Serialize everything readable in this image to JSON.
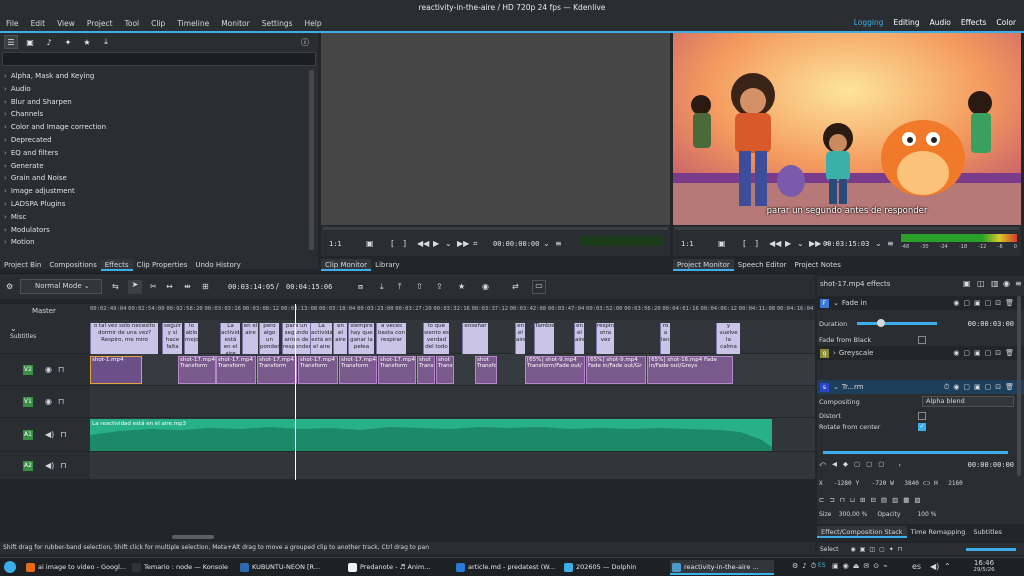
{
  "window": {
    "title": "reactivity-in-the-aire / HD 720p 24 fps — Kdenlive"
  },
  "menu": [
    "File",
    "Edit",
    "View",
    "Project",
    "Tool",
    "Clip",
    "Timeline",
    "Monitor",
    "Settings",
    "Help"
  ],
  "layouts": [
    "Logging",
    "Editing",
    "Audio",
    "Effects",
    "Color"
  ],
  "effects_list": [
    "Alpha, Mask and Keying",
    "Audio",
    "Blur and Sharpen",
    "Channels",
    "Color and Image correction",
    "Deprecated",
    "EQ and filters",
    "Generate",
    "Grain and Noise",
    "Image adjustment",
    "LADSPA Plugins",
    "Misc",
    "Modulators",
    "Motion"
  ],
  "left_tabs": [
    "Project Bin",
    "Compositions",
    "Effects",
    "Clip Properties",
    "Undo History"
  ],
  "center_tabs": [
    "Clip Monitor",
    "Library"
  ],
  "right_tabs": [
    "Project Monitor",
    "Speech Editor",
    "Project Notes"
  ],
  "clip_monitor": {
    "zoom": "1:1",
    "timecode": "00:00:00:00"
  },
  "project_monitor": {
    "zoom": "1:1",
    "timecode": "00:03:15:03",
    "subtitle": "parar un segundo antes de responder",
    "meter": [
      "-48",
      "-30",
      "-24",
      "-18",
      "-12",
      "-6",
      "0"
    ]
  },
  "timeline": {
    "mode": "Normal Mode",
    "position": "00:03:14:05",
    "duration": "00:04:15:06",
    "master_label": "Master",
    "subtitles_label": "Subtitles",
    "tracks": [
      "V2",
      "V1",
      "A1",
      "A2"
    ],
    "ruler": [
      "00:02:49:04",
      "00:02:54:00",
      "00:02:58:20",
      "00:03:03:16",
      "00:03:08:12",
      "00:03:13:08",
      "00:03:18:04",
      "00:03:23:00",
      "00:03:27:20",
      "00:03:32:16",
      "00:03:37:12",
      "00:03:42:08",
      "00:03:47:04",
      "00:03:52:00",
      "00:03:56:20",
      "00:04:01:16",
      "00:04:06:12",
      "00:04:11:08",
      "00:04:16:04"
    ],
    "subtitles": [
      "o tal vez solo necesito dormir de una vez? Respiro, me miro",
      "seguir y si hace falta",
      "lo ablo mejor",
      "La actividad está en el aire",
      "en el aire",
      "pero algo un ponder",
      "para un segundo antes de responder",
      "La actividad está en el aire",
      "en el aire",
      "siempre hay que ganar la pelea",
      "a veces basta con respirar",
      "lo que siento es verdad del todo",
      "enseñar",
      "en el aire",
      "También",
      "en el aire",
      "respira otra vez",
      "ro a lana",
      "y vuelve la calma"
    ],
    "video_clips": [
      "shot-1.mp4",
      "shot-17.mp4 Transform",
      "shot-17.mp4 Transform",
      "shot-17.mp4 Transform",
      "shot-17.mp4 Transform",
      "shot-17.mp4 Transform",
      "shot-17.mp4 Transform",
      "shot Transfo",
      "shot Transf",
      "shot Transform",
      "[65%] shot-9.mp4 Transform/Fade out/",
      "[65%] shot-9.mp4 Fade in/Fade out/Gr",
      "[65%] shot-16.mp4 Fade in/Fade out/Greys"
    ],
    "audio_clip": "La reactividad está en el aire.mp3"
  },
  "effect_stack": {
    "title": "shot-17.mp4 effects",
    "effects": [
      {
        "name": "Fade in",
        "badge": "F",
        "color": "#3c78d8"
      },
      {
        "name": "Greyscale",
        "badge": "g",
        "color": "#8b8b3a"
      },
      {
        "name": "Tr...rm",
        "badge": "s",
        "color": "#2d46c8"
      }
    ],
    "duration_label": "Duration",
    "duration_value": "00:00:03:00",
    "fade_from_black": "Fade from Black",
    "compositing_label": "Compositing",
    "compositing_value": "Alpha blend",
    "distort": "Distort",
    "rotate": "Rotate from center",
    "keyframe_tc": "00:00:00:00",
    "x": "-1280",
    "y": "-720",
    "w": "3840",
    "h": "2160",
    "size_label": "Size",
    "size": "300,00 %",
    "opacity_label": "Opacity",
    "opacity": "100 %",
    "bottom_tabs": [
      "Effect/Composition Stack",
      "Time Remapping",
      "Subtitles"
    ],
    "select_label": "Select"
  },
  "statusbar": "Shift drag for rubber-band selection, Shift click for multiple selection, Meta+Alt drag to move a grouped clip to another track, Ctrl drag to pan",
  "taskbar": {
    "tasks": [
      "ai image to video - Googl...",
      "Temario : node — Konsole",
      "KUBUNTU-NEON [R...",
      "Predanote - ♬ Anim...",
      "article.md - predatest (W...",
      "202605 — Dolphin",
      "reactivity-in-the-aire ..."
    ],
    "lang": "ES",
    "lang2": "es",
    "time": "16:46",
    "date": "29/5/26"
  }
}
